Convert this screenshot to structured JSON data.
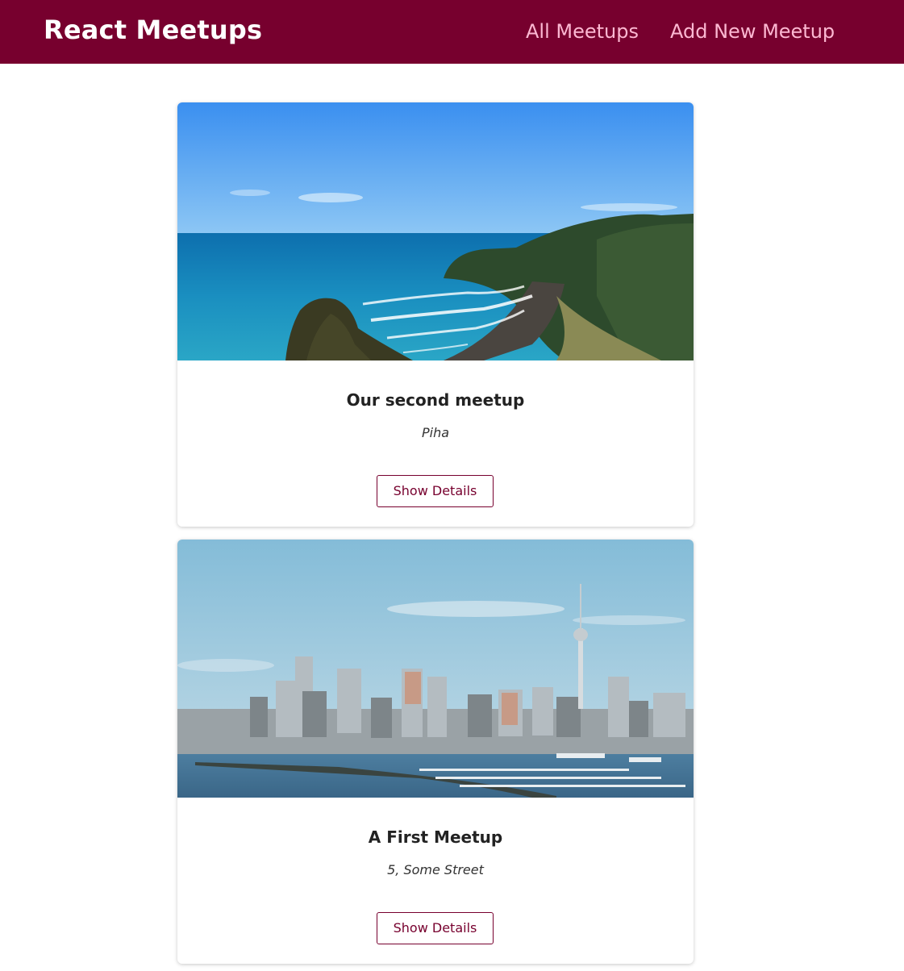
{
  "header": {
    "logo": "React Meetups",
    "nav": {
      "all_meetups": "All Meetups",
      "add_new_meetup": "Add New Meetup"
    }
  },
  "meetups": [
    {
      "title": "Our second meetup",
      "address": "Piha",
      "button_label": "Show Details"
    },
    {
      "title": "A First Meetup",
      "address": "5, Some Street",
      "button_label": "Show Details"
    }
  ],
  "colors": {
    "header_bg": "#77002e",
    "nav_link": "#fcb8d2",
    "accent": "#77002e"
  }
}
